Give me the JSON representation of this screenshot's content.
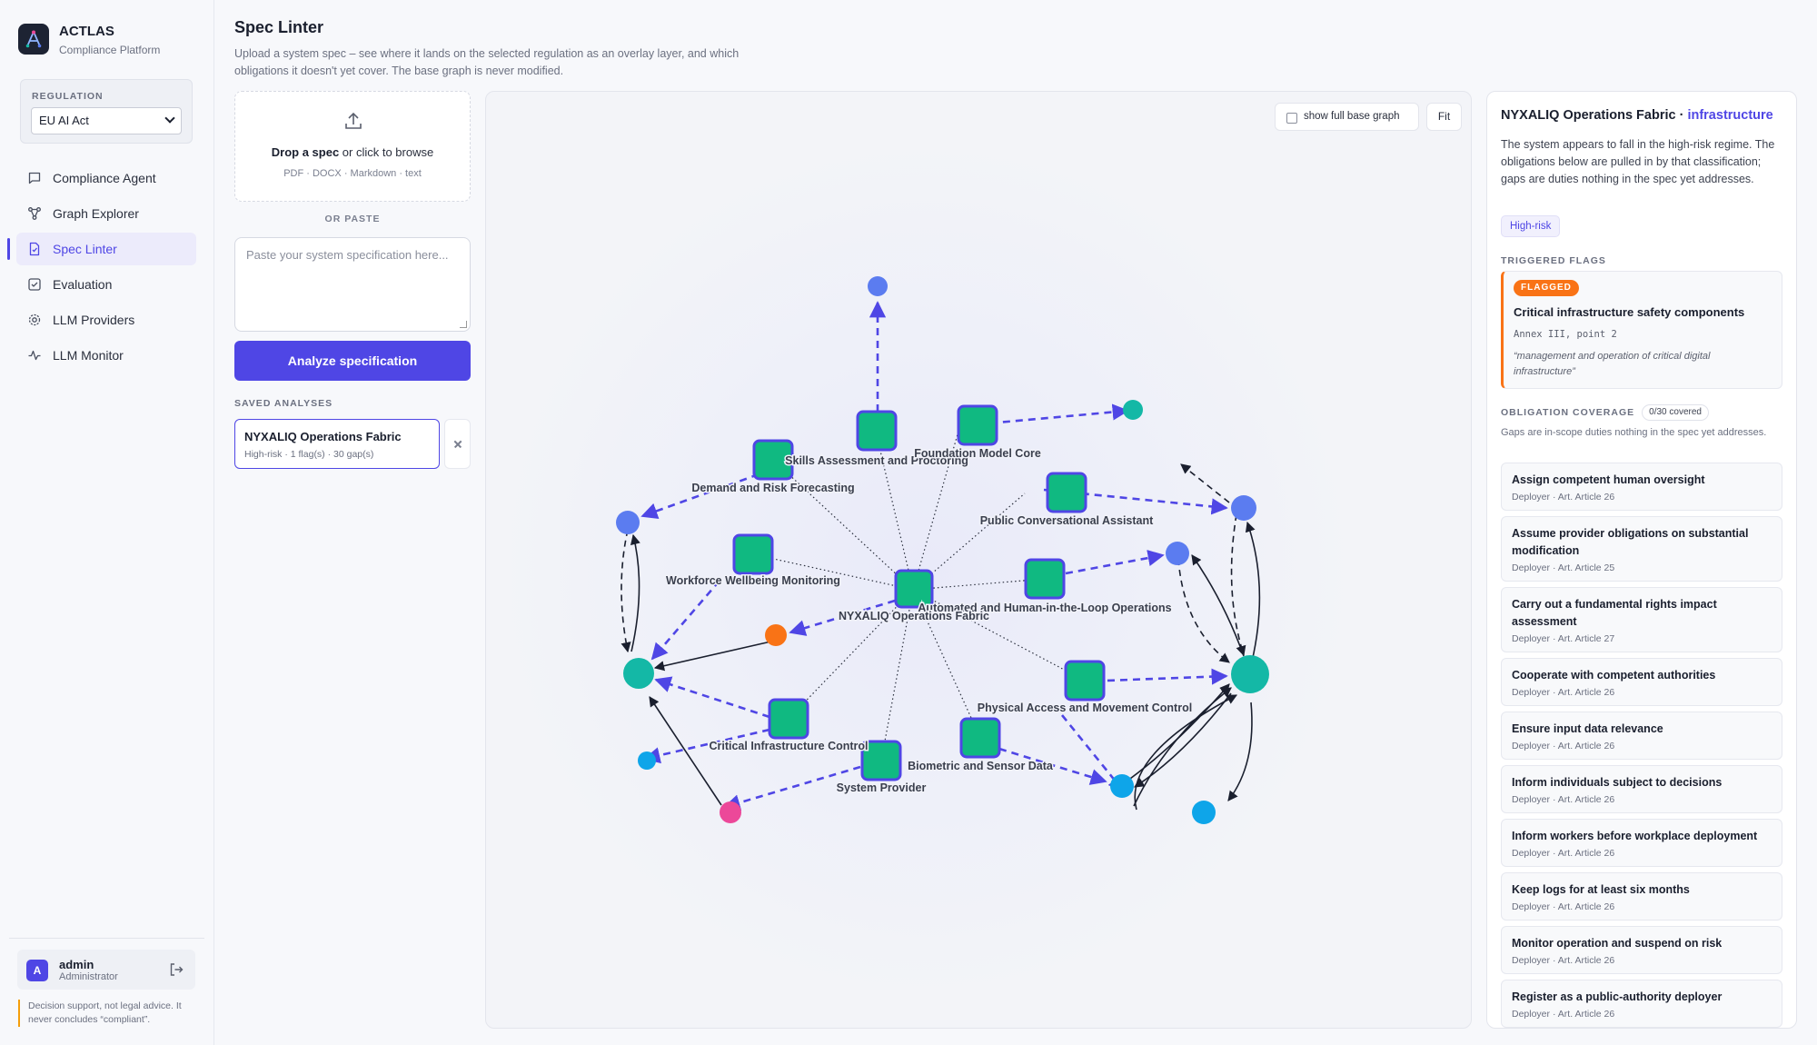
{
  "brand": {
    "name": "ACTLAS",
    "subtitle": "Compliance Platform"
  },
  "regulation": {
    "label": "REGULATION",
    "selected": "EU AI Act"
  },
  "nav": [
    {
      "label": "Compliance Agent",
      "icon": "chat-icon",
      "active": false
    },
    {
      "label": "Graph Explorer",
      "icon": "graph-icon",
      "active": false
    },
    {
      "label": "Spec Linter",
      "icon": "document-icon",
      "active": true
    },
    {
      "label": "Evaluation",
      "icon": "checkbox-icon",
      "active": false
    },
    {
      "label": "LLM Providers",
      "icon": "gear-icon",
      "active": false
    },
    {
      "label": "LLM Monitor",
      "icon": "pulse-icon",
      "active": false
    }
  ],
  "user": {
    "initial": "A",
    "name": "admin",
    "role": "Administrator"
  },
  "disclaimer": "Decision support, not legal advice. It never concludes “compliant”.",
  "page": {
    "title": "Spec Linter",
    "description": "Upload a system spec – see where it lands on the selected regulation as an overlay layer, and which obligations it doesn't yet cover. The base graph is never modified."
  },
  "upload": {
    "drop_bold": "Drop a spec",
    "drop_rest": " or click to browse",
    "types": "PDF · DOCX · Markdown · text",
    "or_paste": "OR PASTE",
    "placeholder": "Paste your system specification here...",
    "analyze_label": "Analyze specification"
  },
  "saved": {
    "label": "SAVED ANALYSES",
    "items": [
      {
        "name": "NYXALIQ Operations Fabric",
        "meta": "High-risk · 1 flag(s) · 30 gap(s)"
      }
    ]
  },
  "graph": {
    "show_base_label": "show full base graph",
    "fit_label": "Fit",
    "colors": {
      "spec": "#10b981",
      "spec_border": "#4f46e5",
      "obligation": "#5b7cf0",
      "regime": "#14b8a6",
      "actor": "#0ea5e9",
      "flag": "#f97316",
      "pink": "#ec4899",
      "gap_edge": "#4f46e5"
    },
    "nodes": [
      {
        "id": "center",
        "label": "NYXALIQ Operations Fabric"
      },
      {
        "id": "skills",
        "label": "Skills Assessment and Proctoring"
      },
      {
        "id": "foundation",
        "label": "Foundation Model Core"
      },
      {
        "id": "demand",
        "label": "Demand and Risk Forecasting"
      },
      {
        "id": "public",
        "label": "Public Conversational Assistant"
      },
      {
        "id": "workforce",
        "label": "Workforce Wellbeing Monitoring"
      },
      {
        "id": "automated",
        "label": "Automated and Human-in-the-Loop Operations"
      },
      {
        "id": "physical",
        "label": "Physical Access and Movement Control"
      },
      {
        "id": "critical",
        "label": "Critical Infrastructure Control"
      },
      {
        "id": "biometric",
        "label": "Biometric and Sensor Data"
      },
      {
        "id": "provider",
        "label": "System Provider"
      }
    ]
  },
  "details": {
    "title_main": "NYXALIQ Operations Fabric · ",
    "title_accent": "infrastructure",
    "description": "The system appears to fall in the high-risk regime. The obligations below are pulled in by that classification; gaps are duties nothing in the spec yet addresses.",
    "risk_badge": "High-risk",
    "triggered_label": "TRIGGERED FLAGS",
    "flag": {
      "pill": "FLAGGED",
      "title": "Critical infrastructure safety components",
      "ref": "Annex III, point 2",
      "quote": "“management and operation of critical digital infrastructure”"
    },
    "coverage_label": "OBLIGATION COVERAGE",
    "coverage_count": "0/30 covered",
    "coverage_desc": "Gaps are in-scope duties nothing in the spec yet addresses.",
    "obligations": [
      {
        "title": "Assign competent human oversight",
        "meta": "Deployer · Art. Article 26"
      },
      {
        "title": "Assume provider obligations on substantial modification",
        "meta": "Deployer · Art. Article 25"
      },
      {
        "title": "Carry out a fundamental rights impact assessment",
        "meta": "Deployer · Art. Article 27"
      },
      {
        "title": "Cooperate with competent authorities",
        "meta": "Deployer · Art. Article 26"
      },
      {
        "title": "Ensure input data relevance",
        "meta": "Deployer · Art. Article 26"
      },
      {
        "title": "Inform individuals subject to decisions",
        "meta": "Deployer · Art. Article 26"
      },
      {
        "title": "Inform workers before workplace deployment",
        "meta": "Deployer · Art. Article 26"
      },
      {
        "title": "Keep logs for at least six months",
        "meta": "Deployer · Art. Article 26"
      },
      {
        "title": "Monitor operation and suspend on risk",
        "meta": "Deployer · Art. Article 26"
      },
      {
        "title": "Register as a public-authority deployer",
        "meta": "Deployer · Art. Article 26"
      }
    ]
  }
}
